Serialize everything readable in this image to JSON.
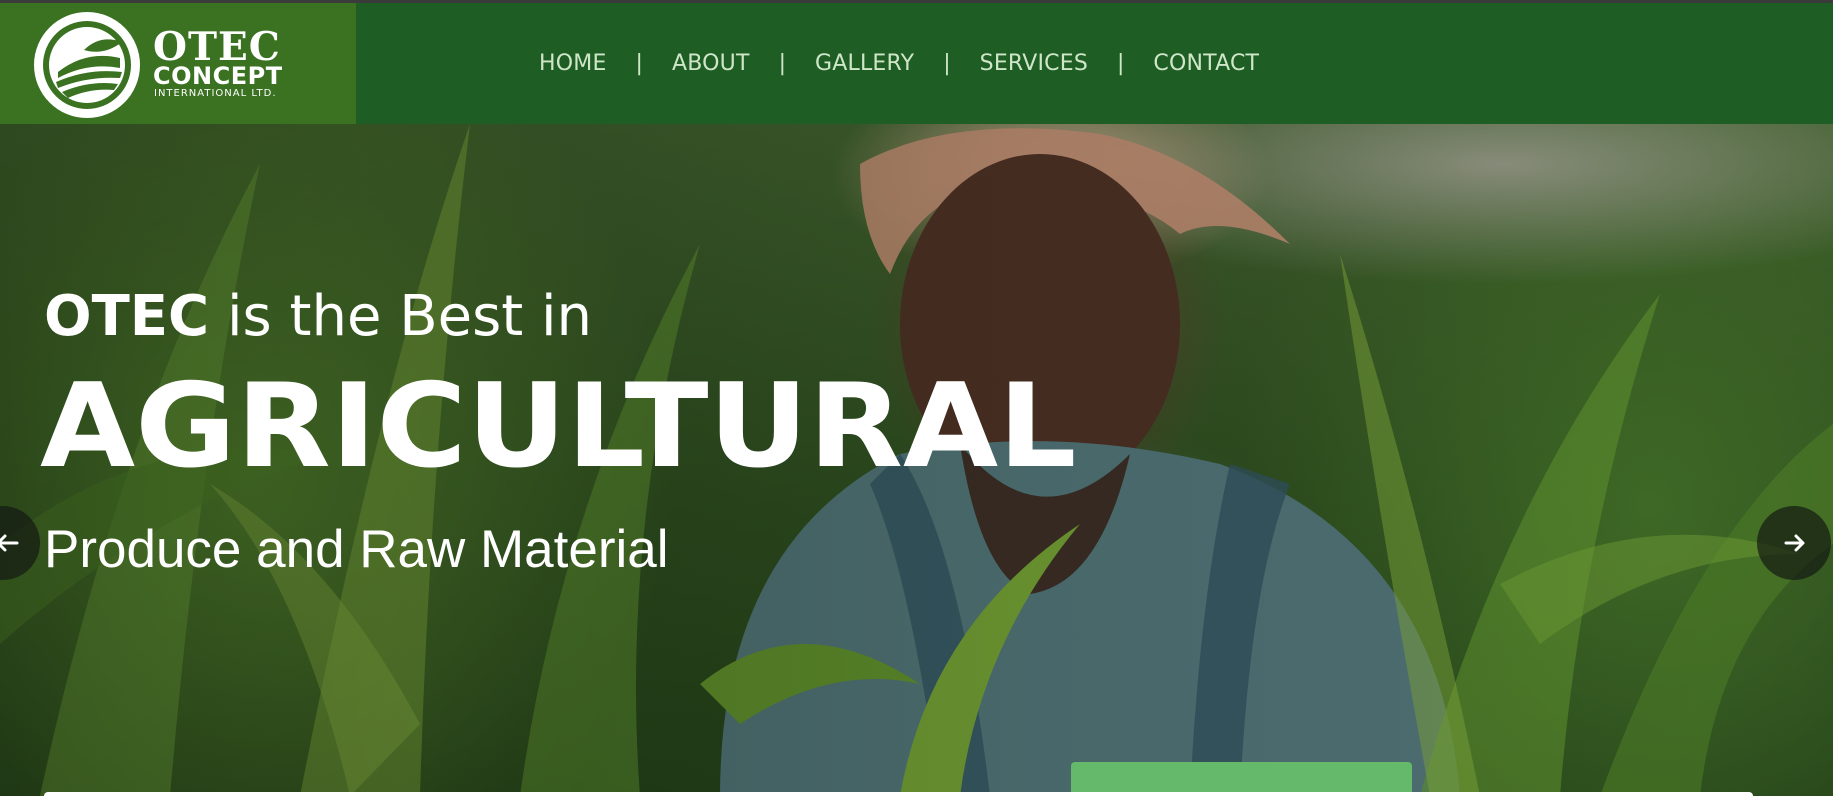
{
  "brand": {
    "name": "OTEC",
    "sub": "CONCEPT",
    "tagline": "INTERNATIONAL LTD."
  },
  "nav": {
    "items": [
      "HOME",
      "ABOUT",
      "GALLERY",
      "SERVICES",
      "CONTACT"
    ],
    "separator": "|"
  },
  "hero": {
    "line1_strong": "OTEC",
    "line1_rest": " is the Best in",
    "headline": "AGRICULTURAL",
    "line3": "Produce and Raw Material"
  },
  "colors": {
    "header_bg": "#1e5e24",
    "logo_bg": "#3a7222",
    "accent_green": "#64b96b"
  },
  "icons": {
    "prev": "arrow-left-icon",
    "next": "arrow-right-icon"
  }
}
